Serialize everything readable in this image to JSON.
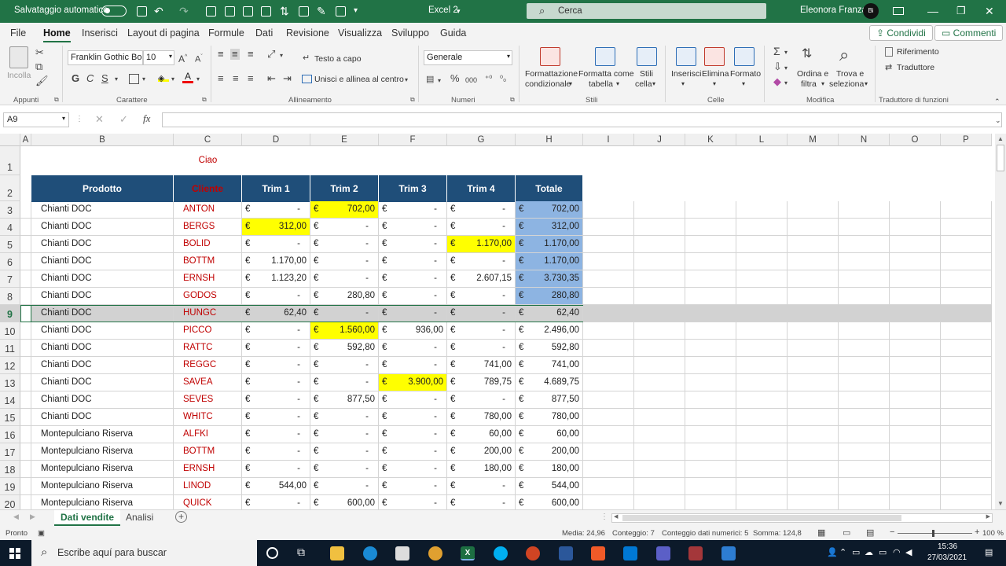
{
  "titlebar": {
    "autosave_label": "Salvataggio automatico",
    "file_title": "Excel 2",
    "search_placeholder": "Cerca",
    "user_name": "Eleonora Franza",
    "avatar_text": "Bi"
  },
  "menu": {
    "tabs": [
      "File",
      "Home",
      "Inserisci",
      "Layout di pagina",
      "Formule",
      "Dati",
      "Revisione",
      "Visualizza",
      "Sviluppo",
      "Guida"
    ],
    "share": "Condividi",
    "comments": "Commenti"
  },
  "ribbon": {
    "clipboard": {
      "paste": "Incolla",
      "group": "Appunti"
    },
    "font": {
      "name": "Franklin Gothic Boo",
      "size": "10",
      "bold": "G",
      "italic": "C",
      "underline": "S",
      "group": "Carattere"
    },
    "alignment": {
      "wrap": "Testo a capo",
      "merge": "Unisci e allinea al centro",
      "group": "Allineamento"
    },
    "number": {
      "format": "Generale",
      "group": "Numeri"
    },
    "styles": {
      "conditional_line1": "Formattazione",
      "conditional_line2": "condizionale",
      "table_line1": "Formatta come",
      "table_line2": "tabella",
      "cell_line1": "Stili",
      "cell_line2": "cella",
      "group": "Stili"
    },
    "cells": {
      "insert": "Inserisci",
      "delete": "Elimina",
      "format": "Formato",
      "group": "Celle"
    },
    "editing": {
      "sort_line1": "Ordina e",
      "sort_line2": "filtra",
      "find_line1": "Trova e",
      "find_line2": "seleziona",
      "group": "Modifica"
    },
    "translator": {
      "reference": "Riferimento",
      "translate": "Traduttore",
      "group": "Traduttore di funzioni"
    }
  },
  "formula_bar": {
    "name_box": "A9",
    "fx": "fx",
    "formula": ""
  },
  "grid": {
    "columns": [
      "A",
      "B",
      "C",
      "D",
      "E",
      "F",
      "G",
      "H",
      "I",
      "J",
      "K",
      "L",
      "M",
      "N",
      "O",
      "P"
    ],
    "row_numbers": [
      "1",
      "2",
      "3",
      "4",
      "5",
      "6",
      "7",
      "8",
      "9",
      "10",
      "11",
      "12",
      "13",
      "14",
      "15",
      "16",
      "17",
      "18",
      "19",
      "20"
    ],
    "title_cell": "Ciao",
    "headers": [
      "Prodotto",
      "Cliente",
      "Trim 1",
      "Trim 2",
      "Trim 3",
      "Trim 4",
      "Totale"
    ],
    "currency": "€",
    "rows": [
      {
        "p": "Chianti DOC",
        "c": "ANTON",
        "t1": "-",
        "t2": "702,00",
        "t3": "-",
        "t4": "-",
        "tot": "702,00"
      },
      {
        "p": "Chianti DOC",
        "c": "BERGS",
        "t1": "312,00",
        "t2": "-",
        "t3": "-",
        "t4": "-",
        "tot": "312,00"
      },
      {
        "p": "Chianti DOC",
        "c": "BOLID",
        "t1": "-",
        "t2": "-",
        "t3": "-",
        "t4": "1.170,00",
        "tot": "1.170,00"
      },
      {
        "p": "Chianti DOC",
        "c": "BOTTM",
        "t1": "1.170,00",
        "t2": "-",
        "t3": "-",
        "t4": "-",
        "tot": "1.170,00"
      },
      {
        "p": "Chianti DOC",
        "c": "ERNSH",
        "t1": "1.123,20",
        "t2": "-",
        "t3": "-",
        "t4": "2.607,15",
        "tot": "3.730,35"
      },
      {
        "p": "Chianti DOC",
        "c": "GODOS",
        "t1": "-",
        "t2": "280,80",
        "t3": "-",
        "t4": "-",
        "tot": "280,80"
      },
      {
        "p": "Chianti DOC",
        "c": "HUNGC",
        "t1": "62,40",
        "t2": "-",
        "t3": "-",
        "t4": "-",
        "tot": "62,40"
      },
      {
        "p": "Chianti DOC",
        "c": "PICCO",
        "t1": "-",
        "t2": "1.560,00",
        "t3": "936,00",
        "t4": "-",
        "tot": "2.496,00"
      },
      {
        "p": "Chianti DOC",
        "c": "RATTC",
        "t1": "-",
        "t2": "592,80",
        "t3": "-",
        "t4": "-",
        "tot": "592,80"
      },
      {
        "p": "Chianti DOC",
        "c": "REGGC",
        "t1": "-",
        "t2": "-",
        "t3": "-",
        "t4": "741,00",
        "tot": "741,00"
      },
      {
        "p": "Chianti DOC",
        "c": "SAVEA",
        "t1": "-",
        "t2": "-",
        "t3": "3.900,00",
        "t4": "789,75",
        "tot": "4.689,75"
      },
      {
        "p": "Chianti DOC",
        "c": "SEVES",
        "t1": "-",
        "t2": "877,50",
        "t3": "-",
        "t4": "-",
        "tot": "877,50"
      },
      {
        "p": "Chianti DOC",
        "c": "WHITC",
        "t1": "-",
        "t2": "-",
        "t3": "-",
        "t4": "780,00",
        "tot": "780,00"
      },
      {
        "p": "Montepulciano Riserva",
        "c": "ALFKI",
        "t1": "-",
        "t2": "-",
        "t3": "-",
        "t4": "60,00",
        "tot": "60,00"
      },
      {
        "p": "Montepulciano Riserva",
        "c": "BOTTM",
        "t1": "-",
        "t2": "-",
        "t3": "-",
        "t4": "200,00",
        "tot": "200,00"
      },
      {
        "p": "Montepulciano Riserva",
        "c": "ERNSH",
        "t1": "-",
        "t2": "-",
        "t3": "-",
        "t4": "180,00",
        "tot": "180,00"
      },
      {
        "p": "Montepulciano Riserva",
        "c": "LINOD",
        "t1": "544,00",
        "t2": "-",
        "t3": "-",
        "t4": "-",
        "tot": "544,00"
      },
      {
        "p": "Montepulciano Riserva",
        "c": "QUICK",
        "t1": "-",
        "t2": "600,00",
        "t3": "-",
        "t4": "-",
        "tot": "600,00"
      }
    ]
  },
  "colors": {
    "excel_green": "#217346",
    "header_blue": "#1f4e79",
    "highlight_yellow": "#ffff00",
    "highlight_blue": "#8db4e2",
    "client_red": "#c00000"
  },
  "sheets": {
    "tabs": [
      "Dati vendite",
      "Analisi"
    ],
    "active": "Dati vendite"
  },
  "status": {
    "ready": "Pronto",
    "average": "Media: 24,96",
    "count": "Conteggio: 7",
    "numeric_count": "Conteggio dati numerici: 5",
    "sum": "Somma: 124,8",
    "zoom": "100 %"
  },
  "taskbar": {
    "search_placeholder": "Escribe aquí para buscar",
    "time": "15:36",
    "date": "27/03/2021"
  }
}
